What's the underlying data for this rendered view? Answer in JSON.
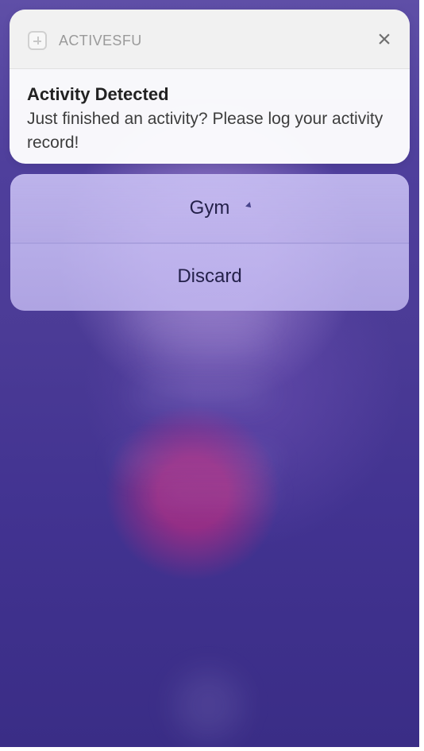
{
  "notification": {
    "app_name": "ACTIVESFU",
    "title": "Activity Detected",
    "body": "Just finished an activity? Please log your activity record!",
    "close_glyph": "×",
    "app_icon": "app-icon"
  },
  "actions": {
    "gym_label": "Gym",
    "discard_label": "Discard"
  },
  "colors": {
    "background_purple": "#4b3b96",
    "notification_bg": "#ffffff",
    "action_bg": "#c9bff4",
    "text_dark": "#24214a"
  }
}
